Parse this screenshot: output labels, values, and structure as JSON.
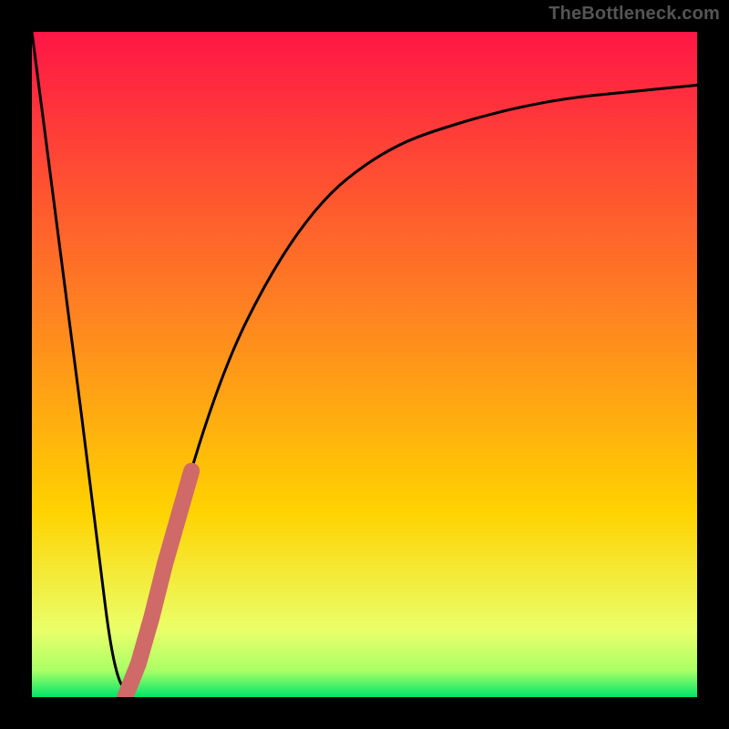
{
  "watermark": "TheBottleneck.com",
  "chart_data": {
    "type": "line",
    "title": "",
    "xlabel": "",
    "ylabel": "",
    "xlim": [
      0,
      100
    ],
    "ylim": [
      0,
      100
    ],
    "grid": false,
    "legend": false,
    "series": [
      {
        "name": "bottleneck-curve",
        "x": [
          0,
          5,
          10,
          12,
          14,
          16,
          20,
          25,
          30,
          35,
          40,
          45,
          50,
          55,
          60,
          70,
          80,
          90,
          100
        ],
        "values": [
          100,
          62,
          22,
          6,
          0,
          5,
          20,
          38,
          52,
          62,
          70,
          76,
          80,
          83,
          85,
          88,
          90,
          91,
          92
        ]
      }
    ],
    "highlight_segment": {
      "name": "highlight",
      "color": "#cf6a68",
      "x": [
        14,
        16,
        18,
        20,
        22,
        24
      ],
      "values": [
        0,
        5,
        12,
        20,
        27,
        34
      ]
    },
    "background_gradient": {
      "top_color": "#ff1646",
      "mid_color": "#ffd200",
      "green_band_top": "#eaff6a",
      "green_band_bottom": "#00e56a"
    }
  }
}
